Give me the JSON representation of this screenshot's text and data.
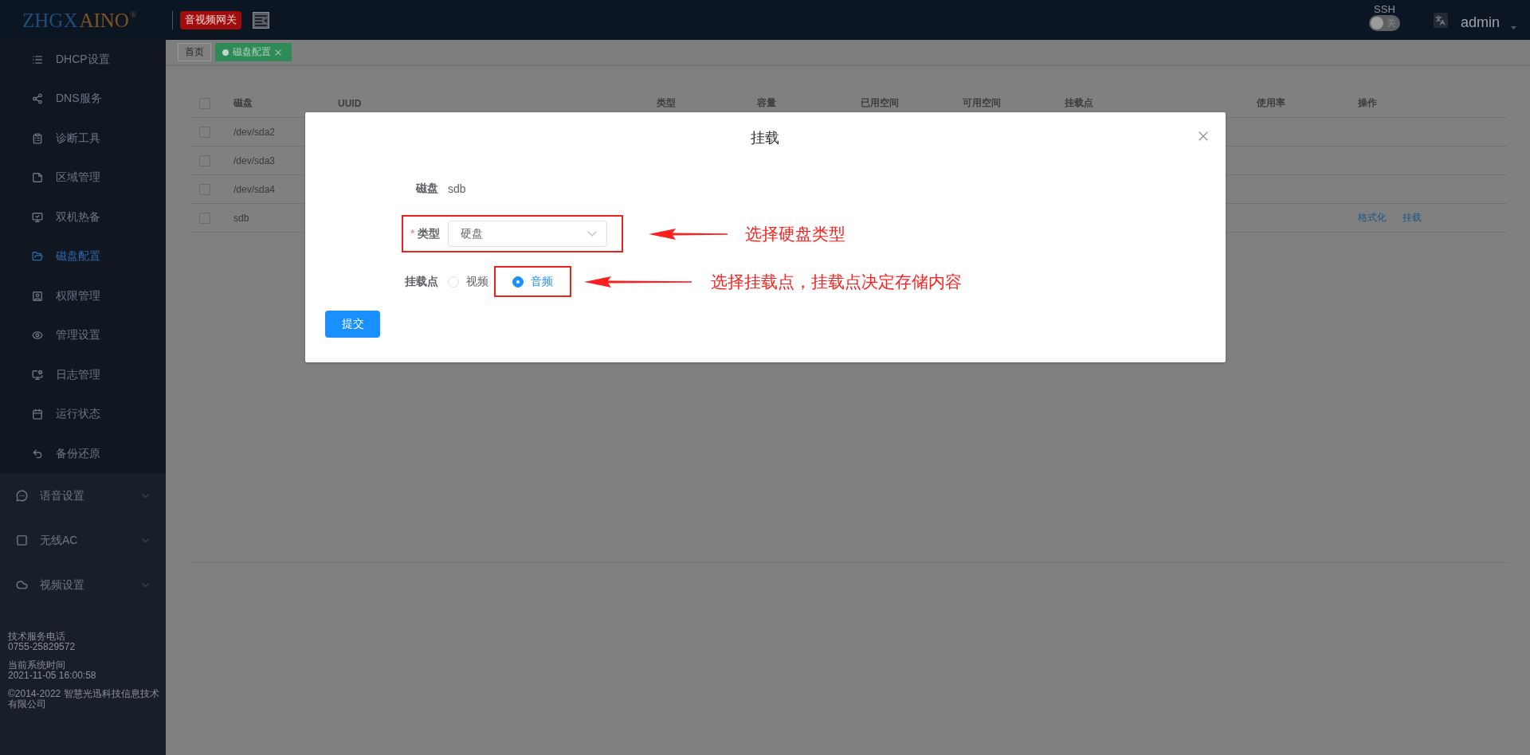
{
  "header": {
    "logo": {
      "left_part": "ZHGX",
      "right_part": "AINO",
      "registered_mark": "®"
    },
    "badge": "音视频网关",
    "ssh": {
      "label": "SSH",
      "on": false,
      "state_text": "关"
    },
    "user": "admin"
  },
  "sidebar": {
    "items": [
      {
        "label": "DHCP设置",
        "selected": false
      },
      {
        "label": "DNS服务",
        "selected": false
      },
      {
        "label": "诊断工具",
        "selected": false
      },
      {
        "label": "区域管理",
        "selected": false
      },
      {
        "label": "双机热备",
        "selected": false
      },
      {
        "label": "磁盘配置",
        "selected": true
      },
      {
        "label": "权限管理",
        "selected": false
      },
      {
        "label": "管理设置",
        "selected": false
      },
      {
        "label": "日志管理",
        "selected": false
      },
      {
        "label": "运行状态",
        "selected": false
      },
      {
        "label": "备份还原",
        "selected": false
      }
    ],
    "groups": [
      {
        "label": "语音设置",
        "expanded": false
      },
      {
        "label": "无线AC",
        "expanded": false
      },
      {
        "label": "视频设置",
        "expanded": false
      }
    ],
    "footer": [
      {
        "lines": [
          "技术服务电话",
          "0755-25829572"
        ]
      },
      {
        "lines": [
          "当前系统时间",
          "2021-11-05 16:00:58"
        ]
      },
      {
        "lines": [
          "©2014-2022 智慧光迅科技信息技术有限公司"
        ]
      }
    ]
  },
  "tabs": [
    {
      "label": "首页",
      "selected": false,
      "closable": false
    },
    {
      "label": "磁盘配置",
      "selected": true,
      "closable": true
    }
  ],
  "table": {
    "select_all_checked": false,
    "columns": [
      "磁盘",
      "UUID",
      "类型",
      "容量",
      "已用空间",
      "可用空间",
      "挂载点",
      "使用率",
      "操作"
    ],
    "rows": [
      {
        "checked": false,
        "disk": "/dev/sda2"
      },
      {
        "checked": false,
        "disk": "/dev/sda3"
      },
      {
        "checked": false,
        "disk": "/dev/sda4"
      },
      {
        "checked": false,
        "disk": "sdb",
        "actions": [
          "格式化",
          "挂载"
        ]
      }
    ]
  },
  "modal": {
    "title": "挂载",
    "fields": [
      {
        "kind": "text",
        "label": "磁盘",
        "value": "sdb"
      },
      {
        "kind": "select",
        "label": "类型",
        "required_mark": "*",
        "value": "硬盘",
        "highlighted": true,
        "callout": "选择硬盘类型"
      },
      {
        "kind": "radio",
        "label": "挂载点",
        "options": [
          {
            "label": "视频",
            "selected": false,
            "highlighted": false
          },
          {
            "label": "音频",
            "selected": true,
            "highlighted": true
          }
        ],
        "callout": "选择挂载点，挂载点决定存储内容"
      }
    ],
    "submit": "提交"
  }
}
